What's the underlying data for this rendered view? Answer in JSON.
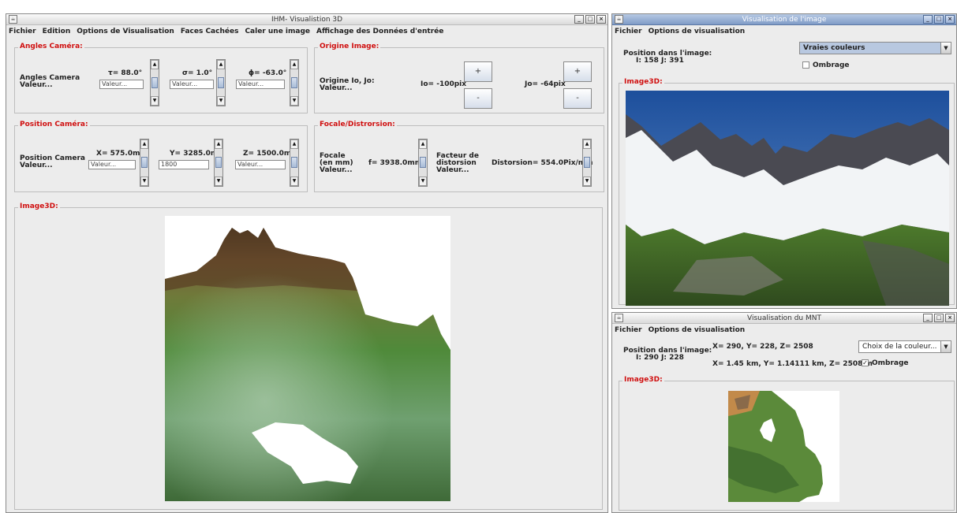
{
  "main": {
    "title": "IHM- Visualistion 3D",
    "menu": [
      "Fichier",
      "Edition",
      "Options de Visualisation",
      "Faces Cachées",
      "Caler une image",
      "Affichage des Données d'entrée"
    ],
    "angles": {
      "title": "Angles Caméra:",
      "label1": "Angles Camera",
      "label2": "Valeur...",
      "tau": "τ= 88.0°",
      "sigma": "σ= 1.0°",
      "phi": "ϕ= -63.0°",
      "tau_field": "Valeur...",
      "sigma_field": "Valeur...",
      "phi_field": "Valeur..."
    },
    "origine": {
      "title": "Origine Image:",
      "label1": "Origine Io, Jo:",
      "label2": "Valeur...",
      "io": "Io= -100pix",
      "jo": "Jo= -64pix",
      "plus": "+",
      "minus": "-"
    },
    "position": {
      "title": "Position Caméra:",
      "label1": "Position Camera",
      "label2": "Valeur...",
      "x": "X= 575.0m",
      "y": "Y= 3285.0m",
      "z": "Z= 1500.0m",
      "x_field": "Valeur...",
      "y_field": "1800",
      "z_field": "Valeur..."
    },
    "focale": {
      "title": "Focale/Distrorsion:",
      "label1": "Focale",
      "label2": "(en mm)",
      "label3": "Valeur...",
      "f": "f= 3938.0mm",
      "dist_label1": "Facteur de",
      "dist_label2": "distorsion",
      "dist_label3": "Valeur...",
      "distorsion": "Distorsion= 554.0Pix/mm"
    },
    "image3d_title": "Image3D:"
  },
  "image_win": {
    "title": "Visualisation de l'image",
    "menu": [
      "Fichier",
      "Options de visualisation"
    ],
    "pos_label": "Position dans l'image:",
    "pos_value": "I: 158 J: 391",
    "color_select": "Vraies couleurs",
    "ombrage": "Ombrage",
    "ombrage_checked": false,
    "image3d_title": "Image3D:"
  },
  "mnt_win": {
    "title": "Visualisation du MNT",
    "menu": [
      "Fichier",
      "Options de visualisation"
    ],
    "pos_label": "Position dans l'image:",
    "pos_value": "I: 290 J: 228",
    "xyz_line": "X= 290,  Y= 228,  Z= 2508",
    "km_line": "X= 1.45 km, Y= 1.14111 km, Z= 2508 m",
    "color_select": "Choix de la couleur...",
    "ombrage": "Ombrage",
    "ombrage_checked": true,
    "image3d_title": "Image3D:"
  },
  "colors": {
    "accent_red": "#d01010",
    "select_blue": "#b8c8e0"
  }
}
